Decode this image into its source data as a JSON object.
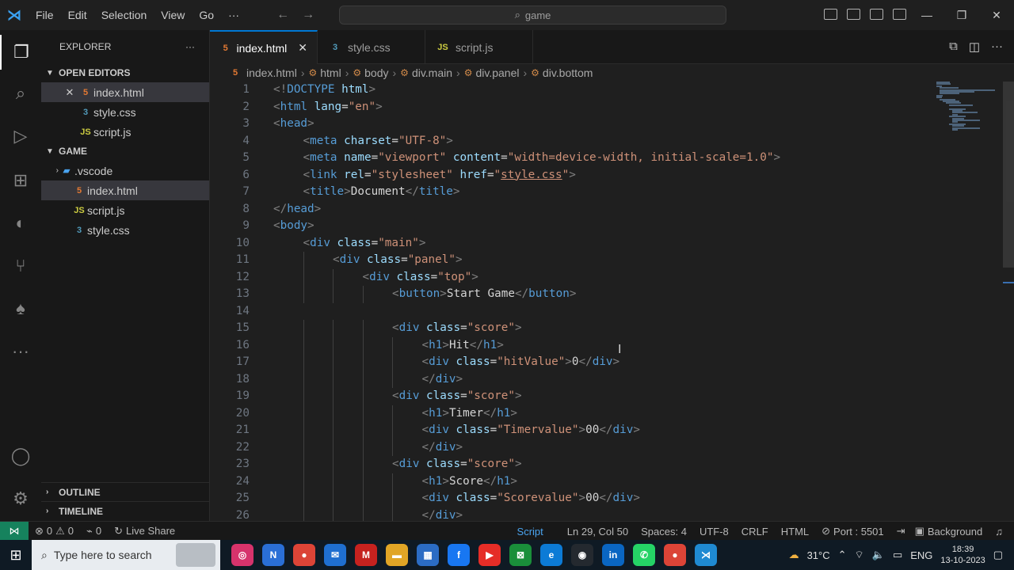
{
  "titlebar": {
    "menu": [
      "File",
      "Edit",
      "Selection",
      "View",
      "Go",
      "···"
    ],
    "search": "game"
  },
  "sidebar": {
    "header": "EXPLORER",
    "more": "···",
    "open_editors_label": "OPEN EDITORS",
    "open_editors": [
      {
        "name": "index.html",
        "type": "html"
      },
      {
        "name": "style.css",
        "type": "css"
      },
      {
        "name": "script.js",
        "type": "js"
      }
    ],
    "folder_label": "GAME",
    "tree": [
      {
        "name": ".vscode",
        "type": "folder"
      },
      {
        "name": "index.html",
        "type": "html"
      },
      {
        "name": "script.js",
        "type": "js"
      },
      {
        "name": "style.css",
        "type": "css"
      }
    ],
    "outline_label": "OUTLINE",
    "timeline_label": "TIMELINE"
  },
  "tabs": [
    {
      "name": "index.html",
      "type": "html",
      "active": true
    },
    {
      "name": "style.css",
      "type": "css",
      "active": false
    },
    {
      "name": "script.js",
      "type": "js",
      "active": false
    }
  ],
  "breadcrumb": [
    "index.html",
    "html",
    "body",
    "div.main",
    "div.panel",
    "div.bottom"
  ],
  "editor": {
    "lines": [
      {
        "n": "1",
        "indent": 0,
        "tokens": [
          [
            "p",
            "<!"
          ],
          [
            "t",
            "DOCTYPE"
          ],
          [
            "a",
            " html"
          ],
          [
            "p",
            ">"
          ]
        ]
      },
      {
        "n": "2",
        "indent": 0,
        "tokens": [
          [
            "p",
            "<"
          ],
          [
            "t",
            "html"
          ],
          [
            "a",
            " lang"
          ],
          [
            "x",
            "="
          ],
          [
            "s",
            "\"en\""
          ],
          [
            "p",
            ">"
          ]
        ]
      },
      {
        "n": "3",
        "indent": 0,
        "tokens": [
          [
            "p",
            "<"
          ],
          [
            "t",
            "head"
          ],
          [
            "p",
            ">"
          ]
        ]
      },
      {
        "n": "4",
        "indent": 1,
        "tokens": [
          [
            "p",
            "<"
          ],
          [
            "t",
            "meta"
          ],
          [
            "a",
            " charset"
          ],
          [
            "x",
            "="
          ],
          [
            "s",
            "\"UTF-8\""
          ],
          [
            "p",
            ">"
          ]
        ]
      },
      {
        "n": "5",
        "indent": 1,
        "tokens": [
          [
            "p",
            "<"
          ],
          [
            "t",
            "meta"
          ],
          [
            "a",
            " name"
          ],
          [
            "x",
            "="
          ],
          [
            "s",
            "\"viewport\""
          ],
          [
            "a",
            " content"
          ],
          [
            "x",
            "="
          ],
          [
            "s",
            "\"width=device-width, initial-scale=1.0\""
          ],
          [
            "p",
            ">"
          ]
        ]
      },
      {
        "n": "6",
        "indent": 1,
        "tokens": [
          [
            "p",
            "<"
          ],
          [
            "t",
            "link"
          ],
          [
            "a",
            " rel"
          ],
          [
            "x",
            "="
          ],
          [
            "s",
            "\"stylesheet\""
          ],
          [
            "a",
            " href"
          ],
          [
            "x",
            "="
          ],
          [
            "s",
            "\""
          ],
          [
            "su",
            "style.css"
          ],
          [
            "s",
            "\""
          ],
          [
            "p",
            ">"
          ]
        ]
      },
      {
        "n": "7",
        "indent": 1,
        "tokens": [
          [
            "p",
            "<"
          ],
          [
            "t",
            "title"
          ],
          [
            "p",
            ">"
          ],
          [
            "x",
            "Document"
          ],
          [
            "p",
            "</"
          ],
          [
            "t",
            "title"
          ],
          [
            "p",
            ">"
          ]
        ]
      },
      {
        "n": "8",
        "indent": 0,
        "tokens": [
          [
            "p",
            "</"
          ],
          [
            "t",
            "head"
          ],
          [
            "p",
            ">"
          ]
        ]
      },
      {
        "n": "9",
        "indent": 0,
        "tokens": [
          [
            "p",
            "<"
          ],
          [
            "t",
            "body"
          ],
          [
            "p",
            ">"
          ]
        ]
      },
      {
        "n": "10",
        "indent": 1,
        "tokens": [
          [
            "p",
            "<"
          ],
          [
            "t",
            "div"
          ],
          [
            "a",
            " class"
          ],
          [
            "x",
            "="
          ],
          [
            "s",
            "\"main\""
          ],
          [
            "p",
            ">"
          ]
        ]
      },
      {
        "n": "11",
        "indent": 2,
        "tokens": [
          [
            "p",
            "<"
          ],
          [
            "t",
            "div"
          ],
          [
            "a",
            " class"
          ],
          [
            "x",
            "="
          ],
          [
            "s",
            "\"panel\""
          ],
          [
            "p",
            ">"
          ]
        ]
      },
      {
        "n": "12",
        "indent": 3,
        "tokens": [
          [
            "p",
            "<"
          ],
          [
            "t",
            "div"
          ],
          [
            "a",
            " class"
          ],
          [
            "x",
            "="
          ],
          [
            "s",
            "\"top\""
          ],
          [
            "p",
            ">"
          ]
        ]
      },
      {
        "n": "13",
        "indent": 4,
        "tokens": [
          [
            "p",
            "<"
          ],
          [
            "t",
            "button"
          ],
          [
            "p",
            ">"
          ],
          [
            "x",
            "Start Game"
          ],
          [
            "p",
            "</"
          ],
          [
            "t",
            "button"
          ],
          [
            "p",
            ">"
          ]
        ]
      },
      {
        "n": "14",
        "indent": 0,
        "tokens": []
      },
      {
        "n": "15",
        "indent": 4,
        "tokens": [
          [
            "p",
            "<"
          ],
          [
            "t",
            "div"
          ],
          [
            "a",
            " class"
          ],
          [
            "x",
            "="
          ],
          [
            "s",
            "\"score\""
          ],
          [
            "p",
            ">"
          ]
        ]
      },
      {
        "n": "16",
        "indent": 5,
        "tokens": [
          [
            "p",
            "<"
          ],
          [
            "t",
            "h1"
          ],
          [
            "p",
            ">"
          ],
          [
            "x",
            "Hit"
          ],
          [
            "p",
            "</"
          ],
          [
            "t",
            "h1"
          ],
          [
            "p",
            ">"
          ]
        ]
      },
      {
        "n": "17",
        "indent": 5,
        "tokens": [
          [
            "p",
            "<"
          ],
          [
            "t",
            "div"
          ],
          [
            "a",
            " class"
          ],
          [
            "x",
            "="
          ],
          [
            "s",
            "\"hitValue\""
          ],
          [
            "p",
            ">"
          ],
          [
            "x",
            "0"
          ],
          [
            "p",
            "</"
          ],
          [
            "t",
            "div"
          ],
          [
            "p",
            ">"
          ]
        ]
      },
      {
        "n": "18",
        "indent": 5,
        "tokens": [
          [
            "p",
            "</"
          ],
          [
            "t",
            "div"
          ],
          [
            "p",
            ">"
          ]
        ]
      },
      {
        "n": "19",
        "indent": 4,
        "tokens": [
          [
            "p",
            "<"
          ],
          [
            "t",
            "div"
          ],
          [
            "a",
            " class"
          ],
          [
            "x",
            "="
          ],
          [
            "s",
            "\"score\""
          ],
          [
            "p",
            ">"
          ]
        ]
      },
      {
        "n": "20",
        "indent": 5,
        "tokens": [
          [
            "p",
            "<"
          ],
          [
            "t",
            "h1"
          ],
          [
            "p",
            ">"
          ],
          [
            "x",
            "Timer"
          ],
          [
            "p",
            "</"
          ],
          [
            "t",
            "h1"
          ],
          [
            "p",
            ">"
          ]
        ]
      },
      {
        "n": "21",
        "indent": 5,
        "tokens": [
          [
            "p",
            "<"
          ],
          [
            "t",
            "div"
          ],
          [
            "a",
            " class"
          ],
          [
            "x",
            "="
          ],
          [
            "s",
            "\"Timervalue\""
          ],
          [
            "p",
            ">"
          ],
          [
            "x",
            "00"
          ],
          [
            "p",
            "</"
          ],
          [
            "t",
            "div"
          ],
          [
            "p",
            ">"
          ]
        ]
      },
      {
        "n": "22",
        "indent": 5,
        "tokens": [
          [
            "p",
            "</"
          ],
          [
            "t",
            "div"
          ],
          [
            "p",
            ">"
          ]
        ]
      },
      {
        "n": "23",
        "indent": 4,
        "tokens": [
          [
            "p",
            "<"
          ],
          [
            "t",
            "div"
          ],
          [
            "a",
            " class"
          ],
          [
            "x",
            "="
          ],
          [
            "s",
            "\"score\""
          ],
          [
            "p",
            ">"
          ]
        ]
      },
      {
        "n": "24",
        "indent": 5,
        "tokens": [
          [
            "p",
            "<"
          ],
          [
            "t",
            "h1"
          ],
          [
            "p",
            ">"
          ],
          [
            "x",
            "Score"
          ],
          [
            "p",
            "</"
          ],
          [
            "t",
            "h1"
          ],
          [
            "p",
            ">"
          ]
        ]
      },
      {
        "n": "25",
        "indent": 5,
        "tokens": [
          [
            "p",
            "<"
          ],
          [
            "t",
            "div"
          ],
          [
            "a",
            " class"
          ],
          [
            "x",
            "="
          ],
          [
            "s",
            "\"Scorevalue\""
          ],
          [
            "p",
            ">"
          ],
          [
            "x",
            "00"
          ],
          [
            "p",
            "</"
          ],
          [
            "t",
            "div"
          ],
          [
            "p",
            ">"
          ]
        ]
      },
      {
        "n": "26",
        "indent": 5,
        "tokens": [
          [
            "p",
            "</"
          ],
          [
            "t",
            "div"
          ],
          [
            "p",
            ">"
          ]
        ]
      }
    ]
  },
  "statusbar": {
    "errors": "0",
    "warnings": "0",
    "ports": "0",
    "live_share": "Live Share",
    "script": "Script",
    "position": "Ln 29, Col 50",
    "spaces": "Spaces: 4",
    "encoding": "UTF-8",
    "eol": "CRLF",
    "language": "HTML",
    "port": "Port : 5501",
    "background": "Background"
  },
  "taskbar": {
    "search_placeholder": "Type here to search",
    "weather": "31°C",
    "lang": "ENG",
    "time": "18:39",
    "date": "13-10-2023",
    "apps": [
      {
        "name": "instagram",
        "color": "#d6336c",
        "glyph": "◎"
      },
      {
        "name": "nox",
        "color": "#2a6fd6",
        "glyph": "N"
      },
      {
        "name": "chrome",
        "color": "#db4437",
        "glyph": "●"
      },
      {
        "name": "mail",
        "color": "#1f6fd0",
        "glyph": "✉"
      },
      {
        "name": "gmail",
        "color": "#c5221f",
        "glyph": "M"
      },
      {
        "name": "file-explorer",
        "color": "#e0a526",
        "glyph": "▬"
      },
      {
        "name": "store",
        "color": "#2b6cc4",
        "glyph": "▦"
      },
      {
        "name": "facebook",
        "color": "#1877f2",
        "glyph": "f"
      },
      {
        "name": "youtube",
        "color": "#e52d27",
        "glyph": "▶"
      },
      {
        "name": "xbox",
        "color": "#1a8f3a",
        "glyph": "⊠"
      },
      {
        "name": "edge",
        "color": "#0c7bd6",
        "glyph": "e"
      },
      {
        "name": "github",
        "color": "#24292f",
        "glyph": "◉"
      },
      {
        "name": "linkedin",
        "color": "#0a66c2",
        "glyph": "in"
      },
      {
        "name": "whatsapp",
        "color": "#25d366",
        "glyph": "✆"
      },
      {
        "name": "chrome-2",
        "color": "#db4437",
        "glyph": "●"
      },
      {
        "name": "vscode",
        "color": "#1f8ad2",
        "glyph": "⋊"
      }
    ]
  }
}
